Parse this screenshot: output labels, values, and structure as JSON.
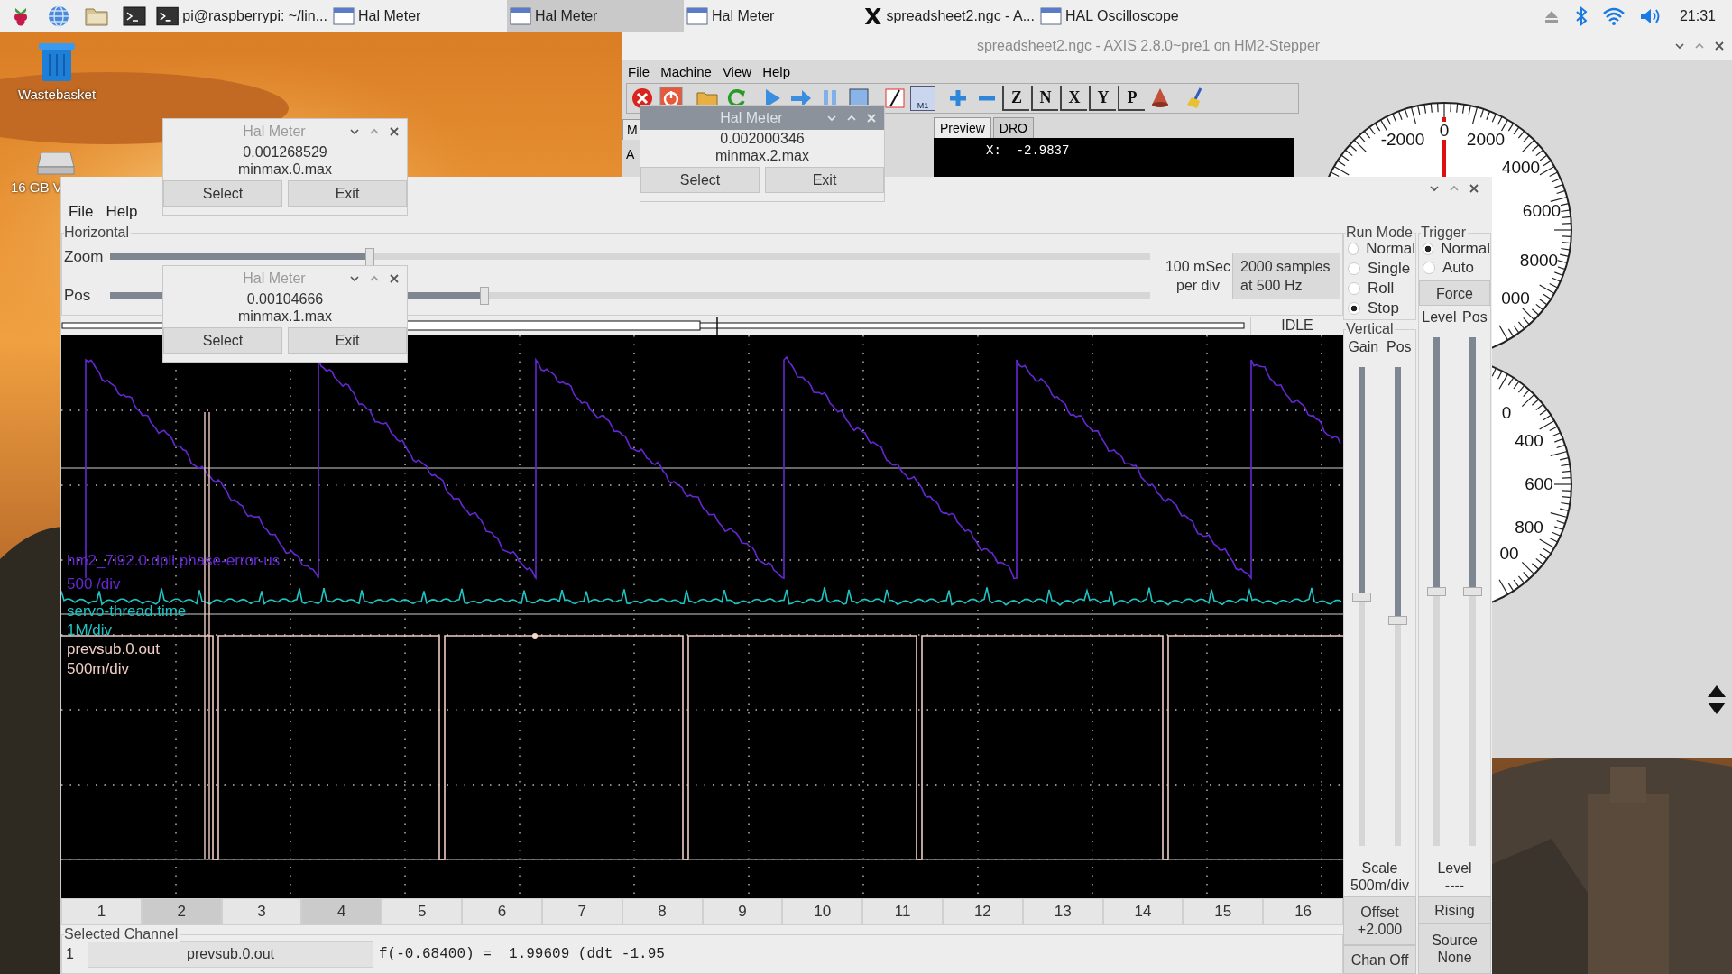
{
  "taskbar": {
    "launchers": [
      {
        "kind": "raspberry"
      },
      {
        "kind": "globe"
      },
      {
        "kind": "folder"
      },
      {
        "kind": "terminal"
      }
    ],
    "tasks": [
      {
        "kind": "terminal",
        "label": "pi@raspberrypi: ~/lin...",
        "selected": false
      },
      {
        "kind": "window",
        "label": "Hal Meter",
        "selected": false
      },
      {
        "kind": "window",
        "label": "Hal Meter",
        "selected": true
      },
      {
        "kind": "window",
        "label": "Hal Meter",
        "selected": false
      },
      {
        "kind": "x",
        "label": "spreadsheet2.ngc - A...",
        "selected": false
      },
      {
        "kind": "window",
        "label": "HAL Oscilloscope",
        "selected": false
      }
    ],
    "tray": [
      {
        "kind": "eject"
      },
      {
        "kind": "bluetooth"
      },
      {
        "kind": "wifi"
      },
      {
        "kind": "volume"
      }
    ],
    "clock": "21:31"
  },
  "desktop_icons": [
    {
      "kind": "trash",
      "label": "Wastebasket"
    },
    {
      "kind": "drive",
      "label": "16 GB V"
    }
  ],
  "axis_window": {
    "title": "spreadsheet2.ngc - AXIS 2.8.0~pre1 on HM2-Stepper",
    "menu": [
      "File",
      "Machine",
      "View",
      "Help"
    ],
    "toolbar": [
      {
        "kind": "estop"
      },
      {
        "kind": "power"
      },
      {
        "kind": "open"
      },
      {
        "kind": "reload"
      },
      {
        "kind": "run"
      },
      {
        "kind": "step"
      },
      {
        "kind": "pause"
      },
      {
        "kind": "stop"
      },
      {
        "kind": "skip"
      },
      {
        "kind": "optional",
        "label": "M1"
      },
      {
        "kind": "zoom-in"
      },
      {
        "kind": "zoom-out"
      },
      {
        "kind": "view",
        "label": "Z"
      },
      {
        "kind": "view",
        "label": "N"
      },
      {
        "kind": "view",
        "label": "X"
      },
      {
        "kind": "view",
        "label": "Y"
      },
      {
        "kind": "view",
        "label": "P"
      },
      {
        "kind": "cone"
      },
      {
        "kind": "clear"
      }
    ],
    "left_tab": "M",
    "left_label": "A",
    "view_tabs": [
      {
        "label": "Preview",
        "selected": true
      },
      {
        "label": "DRO",
        "selected": false
      }
    ],
    "dro_line": "X:  -2.9837",
    "dials": [
      {
        "needle": true,
        "labels": [
          "-2000",
          "0",
          "2000",
          "4000",
          "6000",
          "8000",
          "000"
        ]
      },
      {
        "needle": false,
        "labels": [
          "0",
          "400",
          "600",
          "800",
          "00"
        ]
      }
    ]
  },
  "scope_window": {
    "menu": [
      "File",
      "Help"
    ],
    "horizontal": {
      "title": "Horizontal",
      "zoom": {
        "label": "Zoom",
        "level": 0.25
      },
      "pos": {
        "label": "Pos",
        "level": 0.36
      },
      "rate": [
        "100 mSec",
        "per div"
      ],
      "samples": [
        "2000 samples",
        "at 500 Hz"
      ],
      "state": "IDLE"
    },
    "traces": [
      {
        "kind": "sawtooth",
        "name": "hm2_7i92.0.dpll.phase-error-us",
        "scale": "500 /div",
        "color": "#6428d2"
      },
      {
        "kind": "noise",
        "name": "servo-thread.time",
        "scale": "1M/div",
        "color": "#1ec4c4"
      },
      {
        "kind": "pulse",
        "name": "prevsub.0.out",
        "scale": "500m/div",
        "color": "#f0cdc2"
      }
    ],
    "run_mode": {
      "title": "Run Mode",
      "options": [
        {
          "label": "Normal",
          "selected": false
        },
        {
          "label": "Single",
          "selected": false
        },
        {
          "label": "Roll",
          "selected": false
        },
        {
          "label": "Stop",
          "selected": true
        }
      ]
    },
    "vertical": {
      "title": "Vertical",
      "sliders": [
        {
          "label": "Gain",
          "level": 0.48
        },
        {
          "label": "Pos",
          "level": 0.53
        }
      ],
      "scale_caption": "Scale",
      "scale_value": "500m/div",
      "offset": [
        "Offset",
        "+2.000"
      ],
      "chan_off": "Chan Off"
    },
    "trigger": {
      "title": "Trigger",
      "options": [
        {
          "label": "Normal",
          "selected": true
        },
        {
          "label": "Auto",
          "selected": false
        }
      ],
      "force": "Force",
      "sliders": [
        {
          "label": "Level",
          "level": 0.5
        },
        {
          "label": "Pos",
          "level": 0.5
        }
      ],
      "level_caption": "Level",
      "level_value": "----",
      "edge": "Rising",
      "source": [
        "Source",
        "None"
      ]
    },
    "channels": [
      {
        "label": "1",
        "selected": false
      },
      {
        "label": "2",
        "selected": true
      },
      {
        "label": "3",
        "selected": false
      },
      {
        "label": "4",
        "selected": true
      },
      {
        "label": "5",
        "selected": false
      },
      {
        "label": "6",
        "selected": false
      },
      {
        "label": "7",
        "selected": false
      },
      {
        "label": "8",
        "selected": false
      },
      {
        "label": "9",
        "selected": false
      },
      {
        "label": "10",
        "selected": false
      },
      {
        "label": "11",
        "selected": false
      },
      {
        "label": "12",
        "selected": false
      },
      {
        "label": "13",
        "selected": false
      },
      {
        "label": "14",
        "selected": false
      },
      {
        "label": "15",
        "selected": false
      },
      {
        "label": "16",
        "selected": false
      }
    ],
    "selected_channel": {
      "title": "Selected Channel",
      "number": "1",
      "name": "prevsub.0.out",
      "readout": "f(-0.68400) =  1.99609 (ddt -1.95"
    }
  },
  "meters": [
    {
      "title": "Hal Meter",
      "value": "0.001268529",
      "pin": "minmax.0.max",
      "active": false,
      "buttons": [
        "Select",
        "Exit"
      ]
    },
    {
      "title": "Hal Meter",
      "value": "0.002000346",
      "pin": "minmax.2.max",
      "active": true,
      "buttons": [
        "Select",
        "Exit"
      ]
    },
    {
      "title": "Hal Meter",
      "value": "0.00104666",
      "pin": "minmax.1.max",
      "active": false,
      "buttons": [
        "Select",
        "Exit"
      ]
    }
  ]
}
